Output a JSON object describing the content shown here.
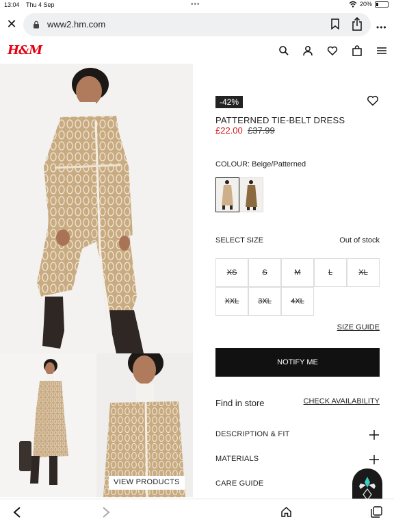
{
  "status_bar": {
    "time": "13:04",
    "date": "Thu 4 Sep",
    "battery": "20%",
    "battery_level": 0.2
  },
  "browser": {
    "url": "www2.hm.com"
  },
  "site": {
    "logo": "H&M",
    "brand_color": "#e50010"
  },
  "product": {
    "discount_badge": "-42%",
    "title": "PATTERNED TIE-BELT DRESS",
    "sale_price": "£22.00",
    "original_price": "£37.99",
    "colour_label": "COLOUR: Beige/Patterned",
    "select_size_label": "SELECT SIZE",
    "stock_status": "Out of stock",
    "sizes": [
      "XS",
      "S",
      "M",
      "L",
      "XL",
      "XXL",
      "3XL",
      "4XL"
    ],
    "size_guide": "SIZE GUIDE",
    "notify_button": "NOTIFY ME",
    "find_in_store": "Find in store",
    "check_availability": "CHECK AVAILABILITY",
    "accordion": [
      "DESCRIPTION & FIT",
      "MATERIALS",
      "CARE GUIDE"
    ]
  },
  "gallery": {
    "view_products": "VIEW PRODUCTS"
  },
  "colors": {
    "sale_red": "#d01c1f",
    "button_black": "#111111",
    "dress_beige": "#c9ab82"
  }
}
